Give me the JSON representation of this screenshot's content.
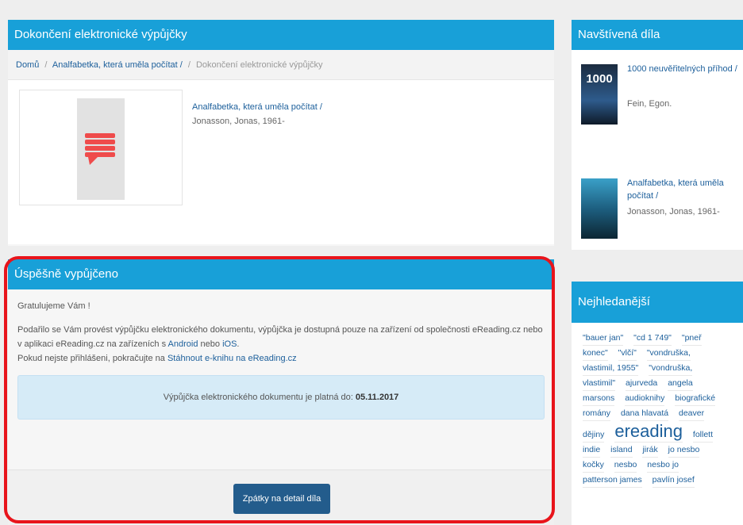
{
  "left_top": {
    "heading": "Dokončení elektronické výpůjčky",
    "breadcrumb": {
      "home": "Domů",
      "book": "Analfabetka, která uměla počítat /",
      "sep": "/",
      "current": "Dokončení elektronické výpůjčky"
    },
    "book": {
      "title": "Analfabetka, která uměla počítat /",
      "author": "Jonasson, Jonas, 1961-"
    }
  },
  "left_bottom": {
    "heading": "Úspěšně vypůjčeno",
    "greeting": "Gratulujeme Vám !",
    "message_part1": "Podařilo se Vám provést výpůjčku elektronického dokumentu, výpůjčka je dostupná pouze na zařízení od společnosti eReading.cz nebo v aplikaci eReading.cz na zařízeních s ",
    "android": "Android",
    "or": " nebo ",
    "ios": "iOS",
    "message_end": ".",
    "login_text": "Pokud nejste přihlášeni, pokračujte na ",
    "login_link": "Stáhnout e-knihu na eReading.cz",
    "validity_text": "Výpůjčka elektronického dokumentu je platná do: ",
    "validity_date": "05.11.2017",
    "back_button": "Zpátky na detail díla"
  },
  "visited": {
    "heading": "Navštívená díla",
    "items": [
      {
        "title": "1000 neuvěřitelných příhod /",
        "author": "Fein, Egon."
      },
      {
        "title": "Analfabetka, která uměla počítat /",
        "author": "Jonasson, Jonas, 1961-"
      }
    ],
    "thumb1_text": "1000"
  },
  "popular": {
    "heading": "Nejhledanější",
    "tags": [
      "\"bauer jan\"",
      "\"cd 1 749\"",
      "\"pneř",
      "konec\"",
      "\"vlčí\"",
      "\"vondruška,",
      "vlastimil, 1955\"",
      "\"vondruška,",
      "vlastimil\"",
      "ajurveda",
      "angela",
      "marsons",
      "audioknihy",
      "biografické",
      "romány",
      "dana hlavatá",
      "deaver",
      "dějiny",
      "ereading",
      "follett",
      "indie",
      "island",
      "jirák",
      "jo nesbo",
      "kočky",
      "nesbo",
      "nesbo jo",
      "patterson james",
      "pavlín josef"
    ]
  },
  "colors": {
    "header_blue": "#18a0d8",
    "link_blue": "#1c5f9b",
    "button_blue": "#235c8c",
    "highlight_red": "#e8141b"
  }
}
